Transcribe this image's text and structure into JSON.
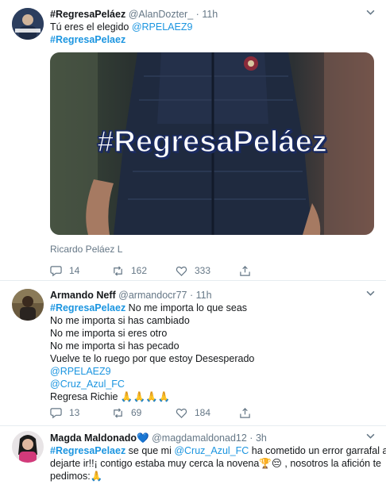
{
  "tweets": [
    {
      "name": "#RegresaPeláez",
      "handle": "@AlanDozter_",
      "time": "11h",
      "lines": [
        [
          {
            "t": "Tú eres el elegido "
          },
          {
            "t": "@RPELAEZ9",
            "c": "blue"
          }
        ],
        [
          {
            "t": "#RegresaPelaez",
            "c": "tag"
          }
        ]
      ],
      "image_overlay": "#RegresaPeláez",
      "caption": "Ricardo Peláez L",
      "reply_count": "14",
      "retweet_count": "162",
      "like_count": "333"
    },
    {
      "name": "Armando Neff",
      "handle": "@armandocr77",
      "time": "11h",
      "lines": [
        [
          {
            "t": "#RegresaPelaez",
            "c": "tag"
          },
          {
            "t": " No me importa lo que seas"
          }
        ],
        [
          {
            "t": "No me importa si has cambiado"
          }
        ],
        [
          {
            "t": "No me importa si eres otro"
          }
        ],
        [
          {
            "t": "No me importa si has pecado"
          }
        ],
        [
          {
            "t": "Vuelve te lo ruego por que estoy Desesperado"
          }
        ],
        [
          {
            "t": "@RPELAEZ9",
            "c": "blue"
          }
        ],
        [
          {
            "t": "@Cruz_Azul_FC",
            "c": "blue"
          }
        ],
        [
          {
            "t": "Regresa Richie 🙏🙏🙏🙏"
          }
        ]
      ],
      "reply_count": "13",
      "retweet_count": "69",
      "like_count": "184"
    },
    {
      "name": "Magda Maldonado",
      "badge": "💙",
      "handle": "@magdamaldonad12",
      "time": "3h",
      "lines": [
        [
          {
            "t": "#RegresaPelaez",
            "c": "tag"
          },
          {
            "t": " se que mi "
          },
          {
            "t": "@Cruz_Azul_FC",
            "c": "blue"
          },
          {
            "t": "  ha cometido un error garrafal al"
          }
        ],
        [
          {
            "t": "dejarte ir!!¡  contigo estaba muy cerca la novena🏆😔 , nosotros la afición te"
          }
        ],
        [
          {
            "t": "pedimos:🙏"
          }
        ]
      ]
    }
  ],
  "colors": {
    "link": "#1b95e0",
    "muted": "#657786",
    "border": "#e6ecf0"
  }
}
